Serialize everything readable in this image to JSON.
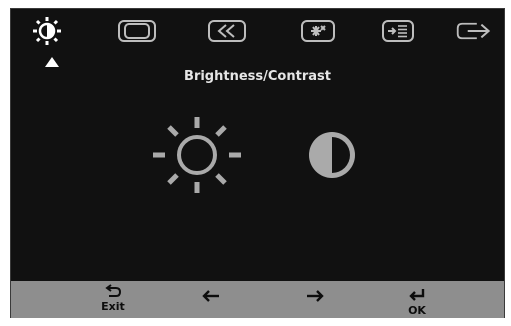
{
  "osd": {
    "tabs": [
      {
        "id": "brightness-contrast",
        "icon": "brightness-icon",
        "selected": true
      },
      {
        "id": "image-position",
        "icon": "image-position-icon",
        "selected": false
      },
      {
        "id": "image-setup",
        "icon": "image-setup-icon",
        "selected": false
      },
      {
        "id": "image-properties",
        "icon": "image-properties-icon",
        "selected": false
      },
      {
        "id": "options",
        "icon": "options-icon",
        "selected": false
      },
      {
        "id": "exit",
        "icon": "exit-icon",
        "selected": false
      }
    ],
    "page_title": "Brightness/Contrast",
    "options": [
      {
        "id": "brightness",
        "icon": "sun-icon"
      },
      {
        "id": "contrast",
        "icon": "contrast-icon"
      }
    ]
  },
  "footer": {
    "exit_label": "Exit",
    "ok_label": "OK",
    "left_icon": "left-arrow-icon",
    "right_icon": "right-arrow-icon"
  },
  "colors": {
    "panel_bg": "#111111",
    "footer_bg": "#8e8e8e",
    "icon_white": "#ffffff",
    "icon_grey": "#bdbdbd",
    "sun_grey": "#aaaaaa"
  }
}
